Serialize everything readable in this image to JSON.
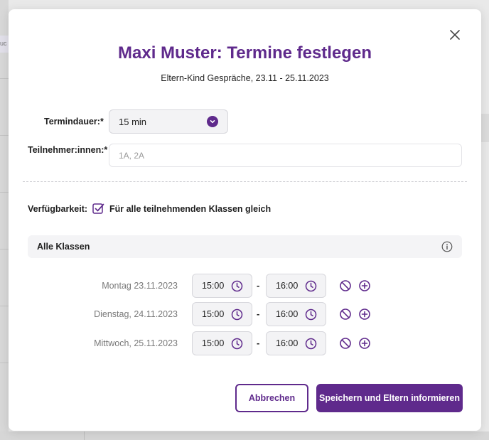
{
  "background": {
    "tab_fragment": "uc"
  },
  "modal": {
    "title": "Maxi Muster: Termine festlegen",
    "subtitle": "Eltern-Kind Gespräche, 23.11 - 25.11.2023",
    "close_icon": "close-icon"
  },
  "form": {
    "duration_label": "Termindauer:*",
    "duration_value": "15 min",
    "participants_label": "Teilnehmer:innen:*",
    "participants_placeholder": "1A, 2A",
    "availability_label": "Verfügbarkeit:",
    "same_for_all_checked": true,
    "same_for_all_label": "Für alle teilnehmenden Klassen gleich"
  },
  "classes": {
    "header": "Alle Klassen",
    "rows": [
      {
        "date": "Montag 23.11.2023",
        "from": "15:00",
        "to": "16:00",
        "separator": "-"
      },
      {
        "date": "Dienstag, 24.11.2023",
        "from": "15:00",
        "to": "16:00",
        "separator": "-"
      },
      {
        "date": "Mittwoch, 25.11.2023",
        "from": "15:00",
        "to": "16:00",
        "separator": "-"
      }
    ]
  },
  "buttons": {
    "cancel": "Abbrechen",
    "save": "Speichern und Eltern informieren"
  },
  "colors": {
    "accent": "#5f2a8c",
    "title": "#5f2a8c",
    "input_bg": "#f3f3f5"
  }
}
